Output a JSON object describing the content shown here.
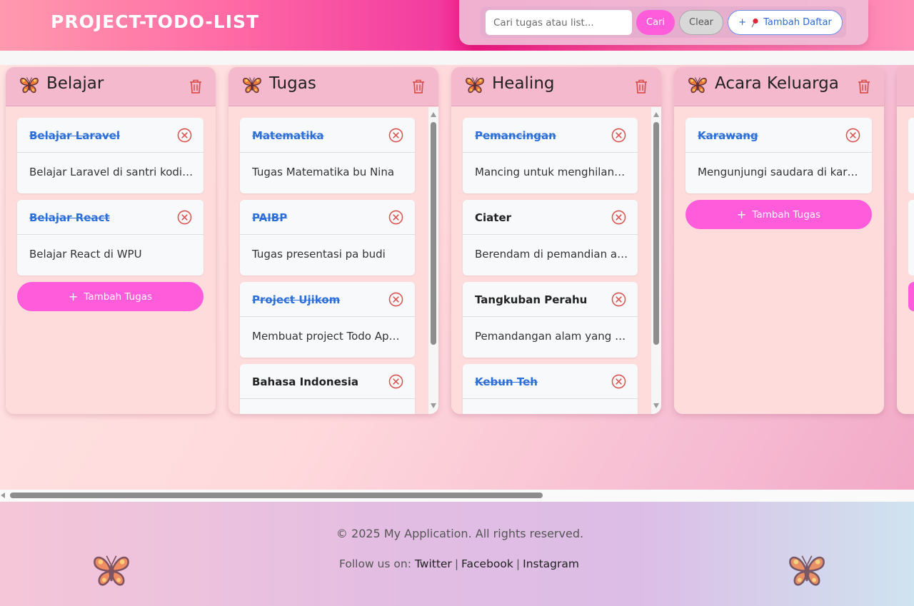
{
  "header": {
    "brand": "PROJECT-TODO-LIST",
    "search_placeholder": "Cari tugas atau list...",
    "search_value": "",
    "search_button": "Cari",
    "clear_button": "Clear",
    "add_list_button": "Tambah Daftar"
  },
  "lists": [
    {
      "title": "Belajar",
      "icon": "butterfly-icon",
      "tasks": [
        {
          "title": "Belajar Laravel",
          "done": true,
          "desc": "Belajar Laravel di santri koding"
        },
        {
          "title": "Belajar React",
          "done": true,
          "desc": "Belajar React di WPU"
        }
      ],
      "add_task_label": "Tambah Tugas"
    },
    {
      "title": "Tugas",
      "icon": "butterfly-icon",
      "tasks": [
        {
          "title": "Matematika",
          "done": true,
          "desc": "Tugas Matematika bu Nina"
        },
        {
          "title": "PAIBP",
          "done": true,
          "desc": "Tugas presentasi pa budi"
        },
        {
          "title": "Project Ujikom",
          "done": true,
          "desc": "Membuat project Todo App..."
        },
        {
          "title": "Bahasa Indonesia",
          "done": false,
          "desc": ""
        }
      ]
    },
    {
      "title": "Healing",
      "icon": "butterfly-icon",
      "tasks": [
        {
          "title": "Pemancingan",
          "done": true,
          "desc": "Mancing untuk menghilang..."
        },
        {
          "title": "Ciater",
          "done": false,
          "desc": "Berendam di pemandian air..."
        },
        {
          "title": "Tangkuban Perahu",
          "done": false,
          "desc": "Pemandangan alam yang in..."
        },
        {
          "title": "Kebun Teh",
          "done": true,
          "desc": ""
        }
      ]
    },
    {
      "title": "Acara Keluarga",
      "icon": "butterfly-icon",
      "tasks": [
        {
          "title": "Karawang",
          "done": true,
          "desc": "Mengunjungi saudara di kara..."
        }
      ],
      "add_task_label": "Tambah Tugas"
    }
  ],
  "footer": {
    "copyright": "© 2025 My Application. All rights reserved.",
    "follow_label": "Follow us on:",
    "links": [
      "Twitter",
      "Facebook",
      "Instagram"
    ]
  },
  "colors": {
    "accent_pink": "#ff5cdc",
    "done_blue": "#2c6fd8",
    "danger_red": "#d9534f"
  }
}
